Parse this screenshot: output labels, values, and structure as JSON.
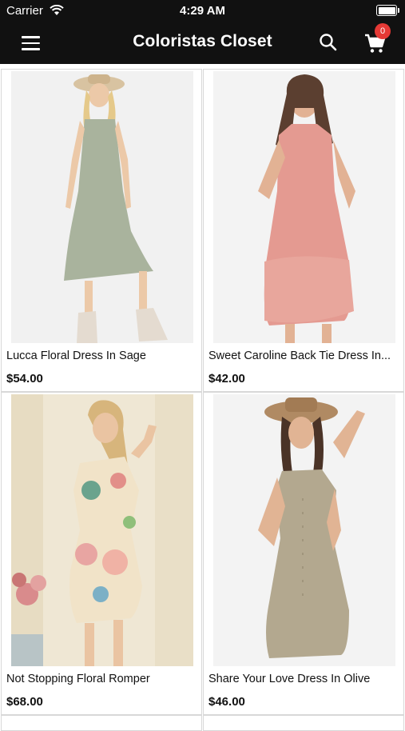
{
  "status_bar": {
    "carrier": "Carrier",
    "time": "4:29 AM"
  },
  "header": {
    "title": "Coloristas Closet",
    "cart_count": "0"
  },
  "icons": [
    "wifi-icon",
    "battery-icon",
    "menu-icon",
    "search-icon",
    "cart-icon"
  ],
  "colors": {
    "header_bg": "#111111",
    "badge": "#e53935"
  },
  "products": [
    {
      "name": "Lucca Floral Dress In Sage",
      "price": "$54.00"
    },
    {
      "name": "Sweet Caroline Back Tie Dress In...",
      "price": "$42.00"
    },
    {
      "name": "Not Stopping Floral Romper",
      "price": "$68.00"
    },
    {
      "name": "Share Your Love Dress In Olive",
      "price": "$46.00"
    }
  ]
}
